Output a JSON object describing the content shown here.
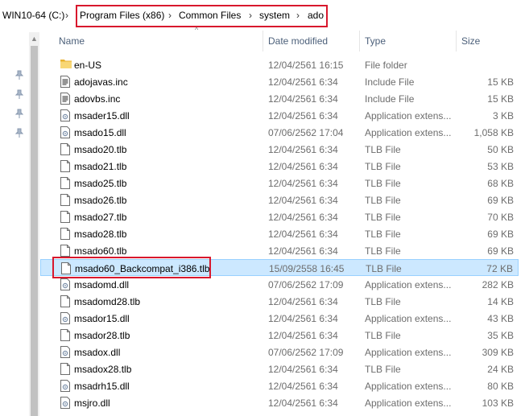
{
  "breadcrumb": {
    "root": "WIN10-64 (C:)",
    "separator": "›",
    "items": [
      "Program Files (x86)",
      "Common Files",
      "system",
      "ado"
    ]
  },
  "columns": {
    "name": "Name",
    "date": "Date modified",
    "type": "Type",
    "size": "Size"
  },
  "files": [
    {
      "name": "en-US",
      "date": "12/04/2561 16:15",
      "type": "File folder",
      "size": "",
      "icon": "folder-icon"
    },
    {
      "name": "adojavas.inc",
      "date": "12/04/2561 6:34",
      "type": "Include File",
      "size": "15 KB",
      "icon": "text-file-icon"
    },
    {
      "name": "adovbs.inc",
      "date": "12/04/2561 6:34",
      "type": "Include File",
      "size": "15 KB",
      "icon": "text-file-icon"
    },
    {
      "name": "msader15.dll",
      "date": "12/04/2561 6:34",
      "type": "Application extens...",
      "size": "3 KB",
      "icon": "dll-file-icon"
    },
    {
      "name": "msado15.dll",
      "date": "07/06/2562 17:04",
      "type": "Application extens...",
      "size": "1,058 KB",
      "icon": "dll-file-icon"
    },
    {
      "name": "msado20.tlb",
      "date": "12/04/2561 6:34",
      "type": "TLB File",
      "size": "50 KB",
      "icon": "blank-file-icon"
    },
    {
      "name": "msado21.tlb",
      "date": "12/04/2561 6:34",
      "type": "TLB File",
      "size": "53 KB",
      "icon": "blank-file-icon"
    },
    {
      "name": "msado25.tlb",
      "date": "12/04/2561 6:34",
      "type": "TLB File",
      "size": "68 KB",
      "icon": "blank-file-icon"
    },
    {
      "name": "msado26.tlb",
      "date": "12/04/2561 6:34",
      "type": "TLB File",
      "size": "69 KB",
      "icon": "blank-file-icon"
    },
    {
      "name": "msado27.tlb",
      "date": "12/04/2561 6:34",
      "type": "TLB File",
      "size": "70 KB",
      "icon": "blank-file-icon"
    },
    {
      "name": "msado28.tlb",
      "date": "12/04/2561 6:34",
      "type": "TLB File",
      "size": "69 KB",
      "icon": "blank-file-icon"
    },
    {
      "name": "msado60.tlb",
      "date": "12/04/2561 6:34",
      "type": "TLB File",
      "size": "69 KB",
      "icon": "blank-file-icon"
    },
    {
      "name": "msado60_Backcompat_i386.tlb",
      "date": "15/09/2558 16:45",
      "type": "TLB File",
      "size": "72 KB",
      "icon": "blank-file-icon",
      "selected": true
    },
    {
      "name": "msadomd.dll",
      "date": "07/06/2562 17:09",
      "type": "Application extens...",
      "size": "282 KB",
      "icon": "dll-file-icon"
    },
    {
      "name": "msadomd28.tlb",
      "date": "12/04/2561 6:34",
      "type": "TLB File",
      "size": "14 KB",
      "icon": "blank-file-icon"
    },
    {
      "name": "msador15.dll",
      "date": "12/04/2561 6:34",
      "type": "Application extens...",
      "size": "43 KB",
      "icon": "dll-file-icon"
    },
    {
      "name": "msador28.tlb",
      "date": "12/04/2561 6:34",
      "type": "TLB File",
      "size": "35 KB",
      "icon": "blank-file-icon"
    },
    {
      "name": "msadox.dll",
      "date": "07/06/2562 17:09",
      "type": "Application extens...",
      "size": "309 KB",
      "icon": "dll-file-icon"
    },
    {
      "name": "msadox28.tlb",
      "date": "12/04/2561 6:34",
      "type": "TLB File",
      "size": "24 KB",
      "icon": "blank-file-icon"
    },
    {
      "name": "msadrh15.dll",
      "date": "12/04/2561 6:34",
      "type": "Application extens...",
      "size": "80 KB",
      "icon": "dll-file-icon"
    },
    {
      "name": "msjro.dll",
      "date": "12/04/2561 6:34",
      "type": "Application extens...",
      "size": "103 KB",
      "icon": "dll-file-icon"
    }
  ],
  "colors": {
    "highlight": "#d8182d",
    "selection": "#cce8ff",
    "folder": "#f3c553"
  }
}
